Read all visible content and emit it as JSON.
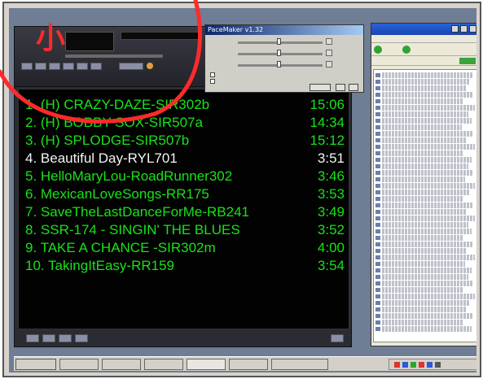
{
  "annotation": {
    "label": "小",
    "color": "#ff2a2a"
  },
  "pacemaker": {
    "title": "PaceMaker v1.32"
  },
  "playlist": {
    "text_color": "#17e317",
    "current_color": "#f4f4f4",
    "current_index": 3,
    "tracks": [
      {
        "title": "1. (H) CRAZY-DAZE-SIR302b",
        "duration": "15:06"
      },
      {
        "title": "2. (H) BOBBY SOX-SIR507a",
        "duration": "14:34"
      },
      {
        "title": "3. (H) SPLODGE-SIR507b",
        "duration": "15:12"
      },
      {
        "title": "4. Beautiful Day-RYL701",
        "duration": "3:51"
      },
      {
        "title": "5. HelloMaryLou-RoadRunner302",
        "duration": "3:46"
      },
      {
        "title": "6. MexicanLoveSongs-RR175",
        "duration": "3:53"
      },
      {
        "title": "7. SaveTheLastDanceForMe-RB241",
        "duration": "3:49"
      },
      {
        "title": "8. SSR-174 - SINGIN' THE BLUES",
        "duration": "3:52"
      },
      {
        "title": "9. TAKE A CHANCE -SIR302m",
        "duration": "4:00"
      },
      {
        "title": "10. TakingItEasy-RR159",
        "duration": "3:54"
      }
    ]
  }
}
